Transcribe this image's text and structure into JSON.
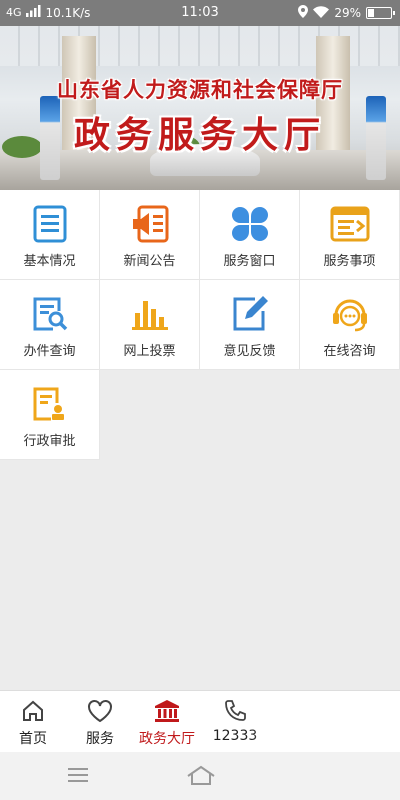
{
  "status_bar": {
    "network": "4G",
    "speed": "10.1K/s",
    "time": "11:03",
    "battery": "29%",
    "battery_level": 0.29,
    "icons": [
      "signal-icon",
      "location-icon",
      "wifi-icon",
      "battery-icon"
    ]
  },
  "banner": {
    "line1": "山东省人力资源和社会保障厅",
    "line2": "政务服务大厅"
  },
  "grid": {
    "items": [
      {
        "label": "基本情况",
        "icon": "document-list-icon",
        "color": "#2f8fd6"
      },
      {
        "label": "新闻公告",
        "icon": "megaphone-icon",
        "color": "#e8661a"
      },
      {
        "label": "服务窗口",
        "icon": "four-petal-icon",
        "color": "#3d8fe0"
      },
      {
        "label": "服务事项",
        "icon": "service-list-icon",
        "color": "#e9a21a"
      },
      {
        "label": "办件查询",
        "icon": "search-document-icon",
        "color": "#3c8fd8"
      },
      {
        "label": "网上投票",
        "icon": "bar-chart-icon",
        "color": "#efa61a"
      },
      {
        "label": "意见反馈",
        "icon": "edit-pen-icon",
        "color": "#3a85cf"
      },
      {
        "label": "在线咨询",
        "icon": "chat-headset-icon",
        "color": "#efa61a"
      },
      {
        "label": "行政审批",
        "icon": "approval-document-icon",
        "color": "#efa61a"
      }
    ]
  },
  "bottom_nav": {
    "items": [
      {
        "label": "首页",
        "icon": "home-icon"
      },
      {
        "label": "服务",
        "icon": "heart-icon"
      },
      {
        "label": "政务大厅",
        "icon": "government-building-icon"
      },
      {
        "label": "12333",
        "icon": "phone-icon"
      }
    ],
    "active_index": 2,
    "active_color": "#c0191b"
  },
  "system_nav": {
    "icons": [
      "menu-icon",
      "home-outline-icon"
    ]
  }
}
